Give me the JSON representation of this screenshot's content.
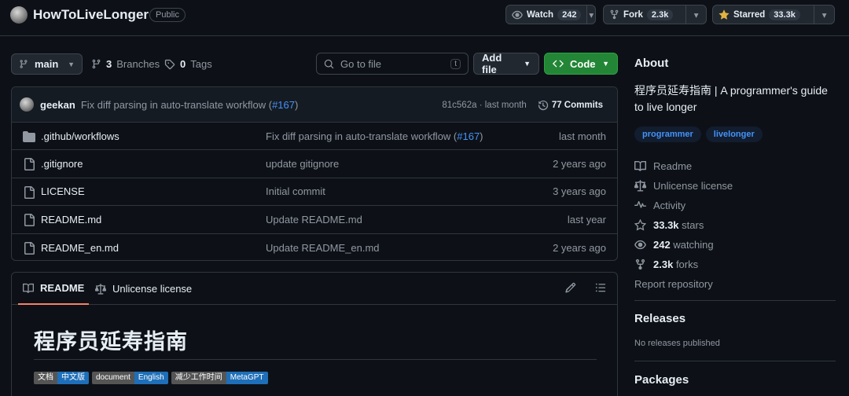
{
  "repo": {
    "name": "HowToLiveLonger",
    "visibility": "Public"
  },
  "header_actions": {
    "watch": {
      "label": "Watch",
      "count": "242"
    },
    "fork": {
      "label": "Fork",
      "count": "2.3k"
    },
    "star": {
      "label": "Starred",
      "count": "33.3k"
    }
  },
  "toolbar": {
    "branch": "main",
    "branches_count": "3",
    "branches_label": "Branches",
    "tags_count": "0",
    "tags_label": "Tags",
    "goto_placeholder": "Go to file",
    "goto_shortcut": "t",
    "add_file_label": "Add file",
    "code_label": "Code"
  },
  "latest_commit": {
    "author": "geekan",
    "message": "Fix diff parsing in auto-translate workflow (",
    "pr": "#167",
    "message_end": ")",
    "sha": "81c562a",
    "separator": "·",
    "age": "last month",
    "commits_count": "77 Commits"
  },
  "files": [
    {
      "name": ".github/workflows",
      "type": "folder",
      "message": "Fix diff parsing in auto-translate workflow (",
      "pr": "#167",
      "message_end": ")",
      "age": "last month"
    },
    {
      "name": ".gitignore",
      "type": "file",
      "message": "update gitignore",
      "pr": "",
      "message_end": "",
      "age": "2 years ago"
    },
    {
      "name": "LICENSE",
      "type": "file",
      "message": "Initial commit",
      "pr": "",
      "message_end": "",
      "age": "3 years ago"
    },
    {
      "name": "README.md",
      "type": "file",
      "message": "Update README.md",
      "pr": "",
      "message_end": "",
      "age": "last year"
    },
    {
      "name": "README_en.md",
      "type": "file",
      "message": "Update README_en.md",
      "pr": "",
      "message_end": "",
      "age": "2 years ago"
    }
  ],
  "readme": {
    "tab_readme": "README",
    "tab_license": "Unlicense license",
    "title": "程序员延寿指南",
    "badges": [
      {
        "left": "文档",
        "right": "中文版"
      },
      {
        "left": "document",
        "right": "English"
      },
      {
        "left": "减少工作时间",
        "right": "MetaGPT"
      }
    ]
  },
  "about": {
    "heading": "About",
    "description": "程序员延寿指南 | A programmer's guide to live longer",
    "topics": [
      "programmer",
      "livelonger"
    ],
    "readme_link": "Readme",
    "license_link": "Unlicense license",
    "activity_link": "Activity",
    "stars_count": "33.3k",
    "stars_label": "stars",
    "watching_count": "242",
    "watching_label": "watching",
    "forks_count": "2.3k",
    "forks_label": "forks",
    "report_link": "Report repository"
  },
  "releases": {
    "heading": "Releases",
    "note": "No releases published"
  },
  "packages": {
    "heading": "Packages"
  },
  "colors": {
    "background": "#0d1117",
    "accent_link": "#4493f8",
    "code_button": "#238636",
    "active_tab_underline": "#f78166"
  }
}
